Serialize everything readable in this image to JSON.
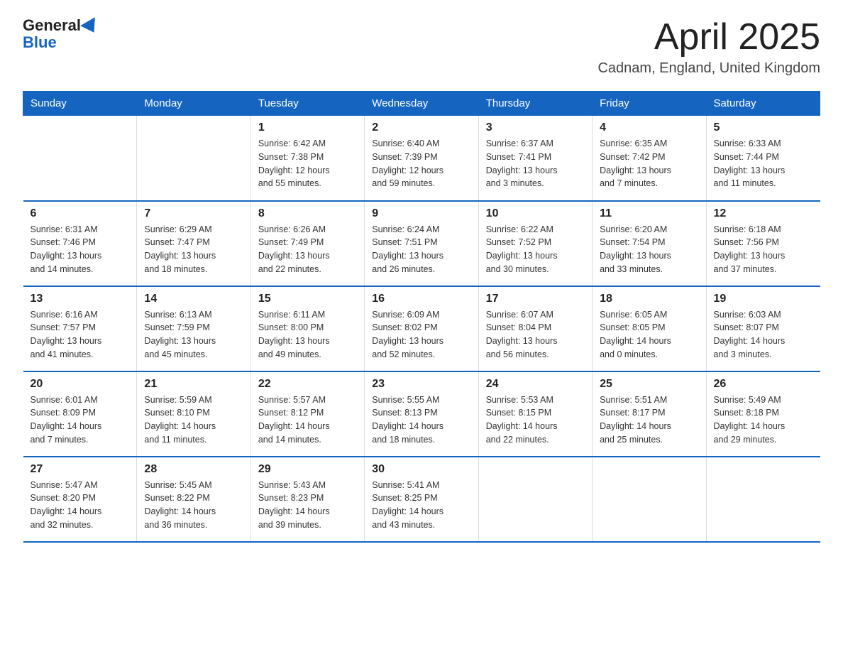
{
  "header": {
    "logo_text_general": "General",
    "logo_text_blue": "Blue",
    "month": "April 2025",
    "location": "Cadnam, England, United Kingdom"
  },
  "days_of_week": [
    "Sunday",
    "Monday",
    "Tuesday",
    "Wednesday",
    "Thursday",
    "Friday",
    "Saturday"
  ],
  "weeks": [
    [
      {
        "day": "",
        "info": ""
      },
      {
        "day": "",
        "info": ""
      },
      {
        "day": "1",
        "info": "Sunrise: 6:42 AM\nSunset: 7:38 PM\nDaylight: 12 hours\nand 55 minutes."
      },
      {
        "day": "2",
        "info": "Sunrise: 6:40 AM\nSunset: 7:39 PM\nDaylight: 12 hours\nand 59 minutes."
      },
      {
        "day": "3",
        "info": "Sunrise: 6:37 AM\nSunset: 7:41 PM\nDaylight: 13 hours\nand 3 minutes."
      },
      {
        "day": "4",
        "info": "Sunrise: 6:35 AM\nSunset: 7:42 PM\nDaylight: 13 hours\nand 7 minutes."
      },
      {
        "day": "5",
        "info": "Sunrise: 6:33 AM\nSunset: 7:44 PM\nDaylight: 13 hours\nand 11 minutes."
      }
    ],
    [
      {
        "day": "6",
        "info": "Sunrise: 6:31 AM\nSunset: 7:46 PM\nDaylight: 13 hours\nand 14 minutes."
      },
      {
        "day": "7",
        "info": "Sunrise: 6:29 AM\nSunset: 7:47 PM\nDaylight: 13 hours\nand 18 minutes."
      },
      {
        "day": "8",
        "info": "Sunrise: 6:26 AM\nSunset: 7:49 PM\nDaylight: 13 hours\nand 22 minutes."
      },
      {
        "day": "9",
        "info": "Sunrise: 6:24 AM\nSunset: 7:51 PM\nDaylight: 13 hours\nand 26 minutes."
      },
      {
        "day": "10",
        "info": "Sunrise: 6:22 AM\nSunset: 7:52 PM\nDaylight: 13 hours\nand 30 minutes."
      },
      {
        "day": "11",
        "info": "Sunrise: 6:20 AM\nSunset: 7:54 PM\nDaylight: 13 hours\nand 33 minutes."
      },
      {
        "day": "12",
        "info": "Sunrise: 6:18 AM\nSunset: 7:56 PM\nDaylight: 13 hours\nand 37 minutes."
      }
    ],
    [
      {
        "day": "13",
        "info": "Sunrise: 6:16 AM\nSunset: 7:57 PM\nDaylight: 13 hours\nand 41 minutes."
      },
      {
        "day": "14",
        "info": "Sunrise: 6:13 AM\nSunset: 7:59 PM\nDaylight: 13 hours\nand 45 minutes."
      },
      {
        "day": "15",
        "info": "Sunrise: 6:11 AM\nSunset: 8:00 PM\nDaylight: 13 hours\nand 49 minutes."
      },
      {
        "day": "16",
        "info": "Sunrise: 6:09 AM\nSunset: 8:02 PM\nDaylight: 13 hours\nand 52 minutes."
      },
      {
        "day": "17",
        "info": "Sunrise: 6:07 AM\nSunset: 8:04 PM\nDaylight: 13 hours\nand 56 minutes."
      },
      {
        "day": "18",
        "info": "Sunrise: 6:05 AM\nSunset: 8:05 PM\nDaylight: 14 hours\nand 0 minutes."
      },
      {
        "day": "19",
        "info": "Sunrise: 6:03 AM\nSunset: 8:07 PM\nDaylight: 14 hours\nand 3 minutes."
      }
    ],
    [
      {
        "day": "20",
        "info": "Sunrise: 6:01 AM\nSunset: 8:09 PM\nDaylight: 14 hours\nand 7 minutes."
      },
      {
        "day": "21",
        "info": "Sunrise: 5:59 AM\nSunset: 8:10 PM\nDaylight: 14 hours\nand 11 minutes."
      },
      {
        "day": "22",
        "info": "Sunrise: 5:57 AM\nSunset: 8:12 PM\nDaylight: 14 hours\nand 14 minutes."
      },
      {
        "day": "23",
        "info": "Sunrise: 5:55 AM\nSunset: 8:13 PM\nDaylight: 14 hours\nand 18 minutes."
      },
      {
        "day": "24",
        "info": "Sunrise: 5:53 AM\nSunset: 8:15 PM\nDaylight: 14 hours\nand 22 minutes."
      },
      {
        "day": "25",
        "info": "Sunrise: 5:51 AM\nSunset: 8:17 PM\nDaylight: 14 hours\nand 25 minutes."
      },
      {
        "day": "26",
        "info": "Sunrise: 5:49 AM\nSunset: 8:18 PM\nDaylight: 14 hours\nand 29 minutes."
      }
    ],
    [
      {
        "day": "27",
        "info": "Sunrise: 5:47 AM\nSunset: 8:20 PM\nDaylight: 14 hours\nand 32 minutes."
      },
      {
        "day": "28",
        "info": "Sunrise: 5:45 AM\nSunset: 8:22 PM\nDaylight: 14 hours\nand 36 minutes."
      },
      {
        "day": "29",
        "info": "Sunrise: 5:43 AM\nSunset: 8:23 PM\nDaylight: 14 hours\nand 39 minutes."
      },
      {
        "day": "30",
        "info": "Sunrise: 5:41 AM\nSunset: 8:25 PM\nDaylight: 14 hours\nand 43 minutes."
      },
      {
        "day": "",
        "info": ""
      },
      {
        "day": "",
        "info": ""
      },
      {
        "day": "",
        "info": ""
      }
    ]
  ]
}
